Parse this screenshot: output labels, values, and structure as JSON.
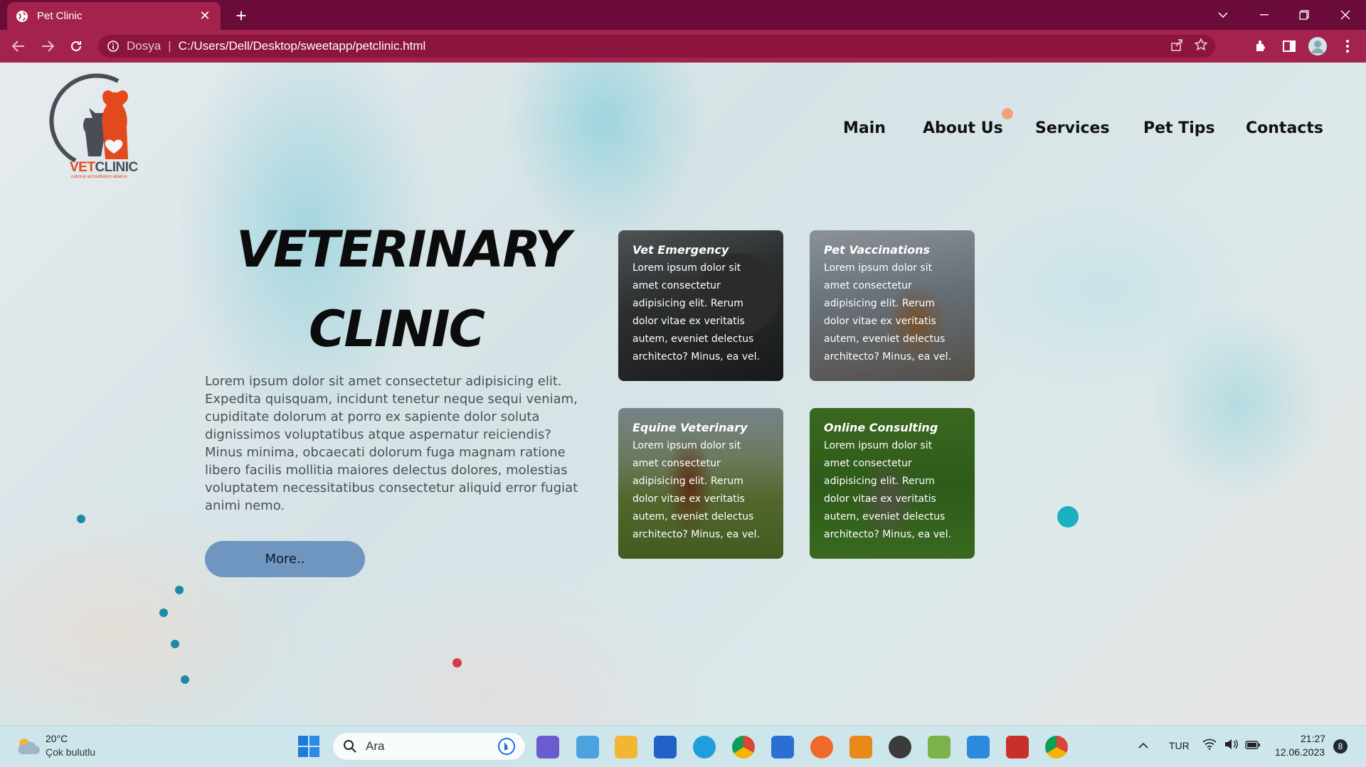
{
  "browser": {
    "tab_title": "Pet Clinic",
    "url_scheme_label": "Dosya",
    "url": "C:/Users/Dell/Desktop/sweetapp/petclinic.html",
    "accent": "#a3234d",
    "tabbar_color": "#6b0b3a"
  },
  "site": {
    "logo_vet": "VET",
    "logo_clinic": "CLINIC",
    "logo_tagline": "national accreditation alliance",
    "nav": [
      "Main",
      "About Us",
      "Services",
      "Pet Tips",
      "Contacts"
    ],
    "hero_line1": "VETERINARY",
    "hero_line2": "CLINIC",
    "hero_text": "Lorem ipsum dolor sit amet consectetur adipisicing elit. Expedita quisquam, incidunt tenetur neque sequi veniam, cupiditate dolorum at porro ex sapiente dolor soluta dignissimos voluptatibus atque aspernatur reiciendis? Minus minima, obcaecati dolorum fuga magnam ratione libero facilis mollitia maiores delectus dolores, molestias voluptatem necessitatibus consectetur aliquid error fugiat animi nemo.",
    "more_button": "More..",
    "button_color": "#6f95c1",
    "cards": [
      {
        "title": "Vet Emergency",
        "body": "Lorem ipsum dolor sit amet consectetur adipisicing elit. Rerum dolor vitae ex veritatis autem, eveniet delectus architecto? Minus, ea vel."
      },
      {
        "title": "Pet Vaccinations",
        "body": "Lorem ipsum dolor sit amet consectetur adipisicing elit. Rerum dolor vitae ex veritatis autem, eveniet delectus architecto? Minus, ea vel."
      },
      {
        "title": "Equine Veterinary",
        "body": "Lorem ipsum dolor sit amet consectetur adipisicing elit. Rerum dolor vitae ex veritatis autem, eveniet delectus architecto? Minus, ea vel."
      },
      {
        "title": "Online Consulting",
        "body": "Lorem ipsum dolor sit amet consectetur adipisicing elit. Rerum dolor vitae ex veritatis autem, eveniet delectus architecto? Minus, ea vel."
      }
    ]
  },
  "taskbar": {
    "weather_temp": "20°C",
    "weather_desc": "Çok bulutlu",
    "search_placeholder": "Ara",
    "language": "TUR",
    "time": "21:27",
    "date": "12.06.2023",
    "notification_count": "8",
    "icons": [
      "windows-start",
      "teams",
      "notepad",
      "file-explorer",
      "store",
      "edge",
      "chrome",
      "mail",
      "firefox",
      "search-app",
      "obs",
      "paint",
      "vscode",
      "recorder",
      "chrome-profile"
    ]
  }
}
